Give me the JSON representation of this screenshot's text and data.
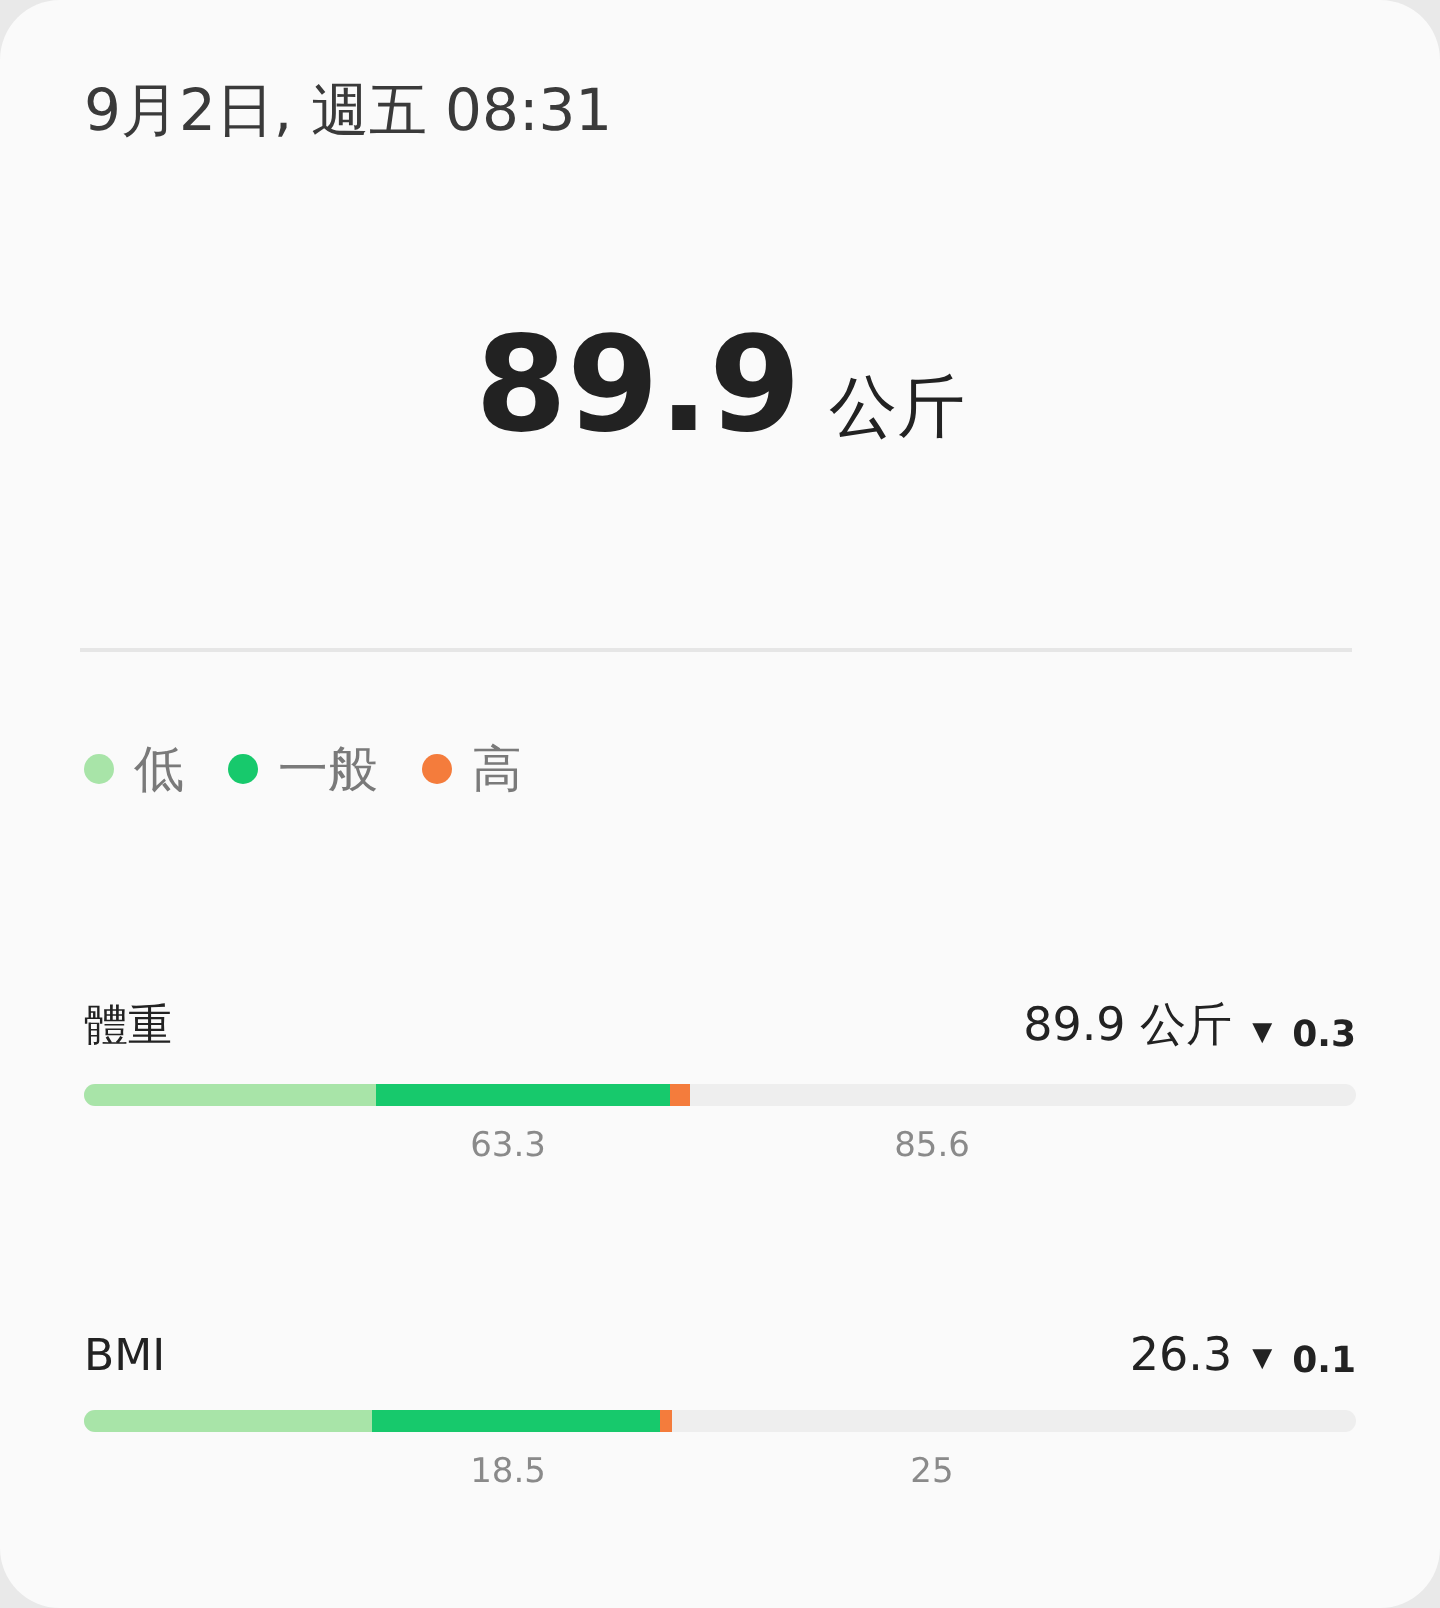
{
  "date": "9月2日, 週五 08:31",
  "weight": {
    "value": "89.9",
    "unit": "公斤"
  },
  "legend": [
    {
      "label": "低",
      "color": "#a8e4a8"
    },
    {
      "label": "一般",
      "color": "#17c96c"
    },
    {
      "label": "高",
      "color": "#f47c3c"
    }
  ],
  "metrics": [
    {
      "name": "體重",
      "value": "89.9 公斤",
      "trend": "▼",
      "change": "0.3",
      "level": 0.69,
      "ticks": [
        "63.3",
        "85.6"
      ]
    },
    {
      "name": "BMI",
      "value": "26.3",
      "trend": "▼",
      "change": "0.1",
      "level": 0.68,
      "ticks": [
        "18.5",
        "25"
      ]
    }
  ]
}
